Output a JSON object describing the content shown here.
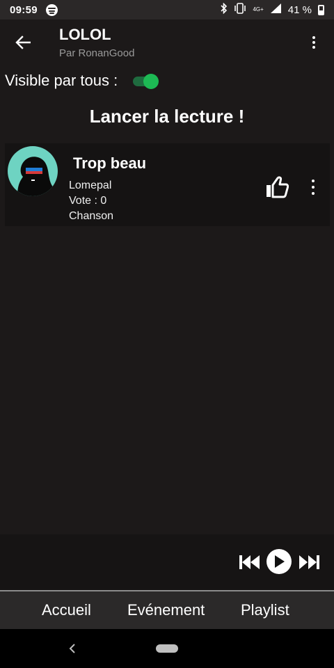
{
  "status_bar": {
    "time": "09:59",
    "network": "4G+",
    "battery_percent": "41 %"
  },
  "app_bar": {
    "title": "LOLOL",
    "subtitle": "Par RonanGood"
  },
  "visibility": {
    "label": "Visible par tous :",
    "enabled": true
  },
  "launch_title": "Lancer la lecture !",
  "tracks": [
    {
      "title": "Trop beau",
      "artist": "Lomepal",
      "votes": "Vote : 0",
      "type": "Chanson"
    }
  ],
  "player": {
    "controls": [
      "previous-icon",
      "play-icon",
      "next-icon"
    ]
  },
  "bottom_nav": {
    "items": [
      "Accueil",
      "Evénement",
      "Playlist"
    ]
  },
  "colors": {
    "background": "#1c1919",
    "accent_green": "#1db954",
    "card": "#151313",
    "cover_teal": "#6ed3c2"
  }
}
